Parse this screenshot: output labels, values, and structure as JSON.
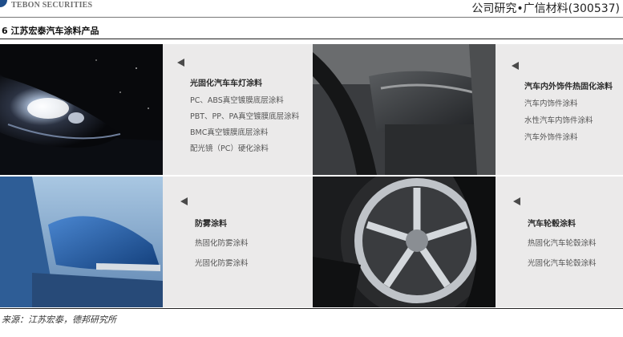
{
  "header": {
    "brand": "TEBON SECURITIES",
    "report": "公司研究•广信材料(300537)"
  },
  "figure": {
    "title": "6 江苏宏泰汽车涂料产品"
  },
  "panels": [
    {
      "title": "光固化汽车车灯涂料",
      "items": [
        "PC、ABS真空镀膜底层涂料",
        "PBT、PP、PA真空镀膜底层涂料",
        "BMC真空镀膜底层涂料",
        "配光镜（PC）硬化涂料"
      ]
    },
    {
      "title": "汽车内外饰件热固化涂料",
      "items": [
        "汽车内饰件涂料",
        "水性汽车内饰件涂料",
        "汽车外饰件涂料"
      ]
    },
    {
      "title": "防雾涂料",
      "items": [
        "热固化防雾涂料",
        "光固化防雾涂料"
      ]
    },
    {
      "title": "汽车轮毂涂料",
      "items": [
        "热固化汽车轮毂涂料",
        "光固化汽车轮毂涂料"
      ]
    }
  ],
  "source": "来源：江苏宏泰，德邦研究所"
}
